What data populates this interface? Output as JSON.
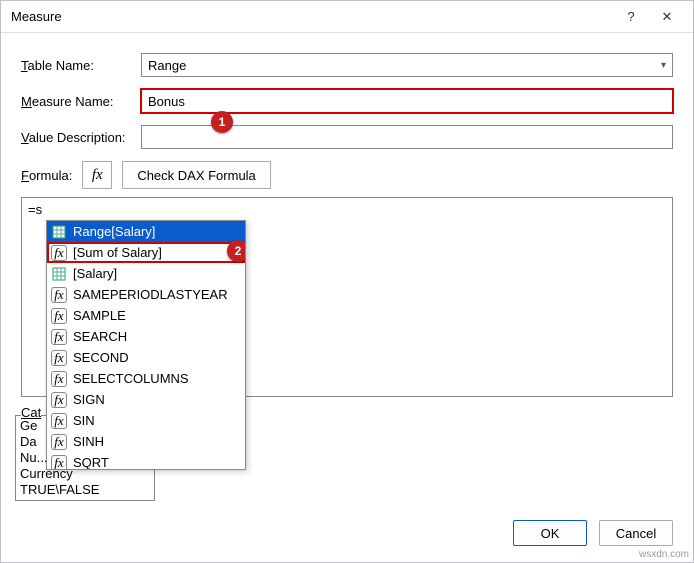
{
  "dialog": {
    "title": "Measure",
    "help_glyph": "?",
    "close_glyph": "✕"
  },
  "fields": {
    "table_name_label": "Table Name:",
    "table_name_value": "Range",
    "measure_name_label": "Measure Name:",
    "measure_name_value": "Bonus",
    "value_desc_label": "Value Description:",
    "value_desc_value": "",
    "formula_label": "Formula:",
    "fx_glyph": "fx",
    "check_dax_label": "Check DAX Formula",
    "formula_text": "=s"
  },
  "annotations": {
    "badge1": "1",
    "badge2": "2"
  },
  "autocomplete": {
    "items": [
      {
        "icon": "table",
        "label": "Range[Salary]",
        "selected": true
      },
      {
        "icon": "fx",
        "label": "[Sum of Salary]",
        "highlight": true
      },
      {
        "icon": "table",
        "label": "[Salary]"
      },
      {
        "icon": "fx",
        "label": "SAMEPERIODLASTYEAR"
      },
      {
        "icon": "fx",
        "label": "SAMPLE"
      },
      {
        "icon": "fx",
        "label": "SEARCH"
      },
      {
        "icon": "fx",
        "label": "SECOND"
      },
      {
        "icon": "fx",
        "label": "SELECTCOLUMNS"
      },
      {
        "icon": "fx",
        "label": "SIGN"
      },
      {
        "icon": "fx",
        "label": "SIN"
      },
      {
        "icon": "fx",
        "label": "SINH"
      },
      {
        "icon": "fx",
        "label": "SQRT"
      }
    ]
  },
  "category": {
    "label_text": "Cat",
    "items": [
      "Ge",
      "Da",
      "Nu...",
      "Currency",
      "TRUE\\FALSE"
    ]
  },
  "buttons": {
    "ok": "OK",
    "cancel": "Cancel"
  },
  "watermark": "wsxdn.com"
}
